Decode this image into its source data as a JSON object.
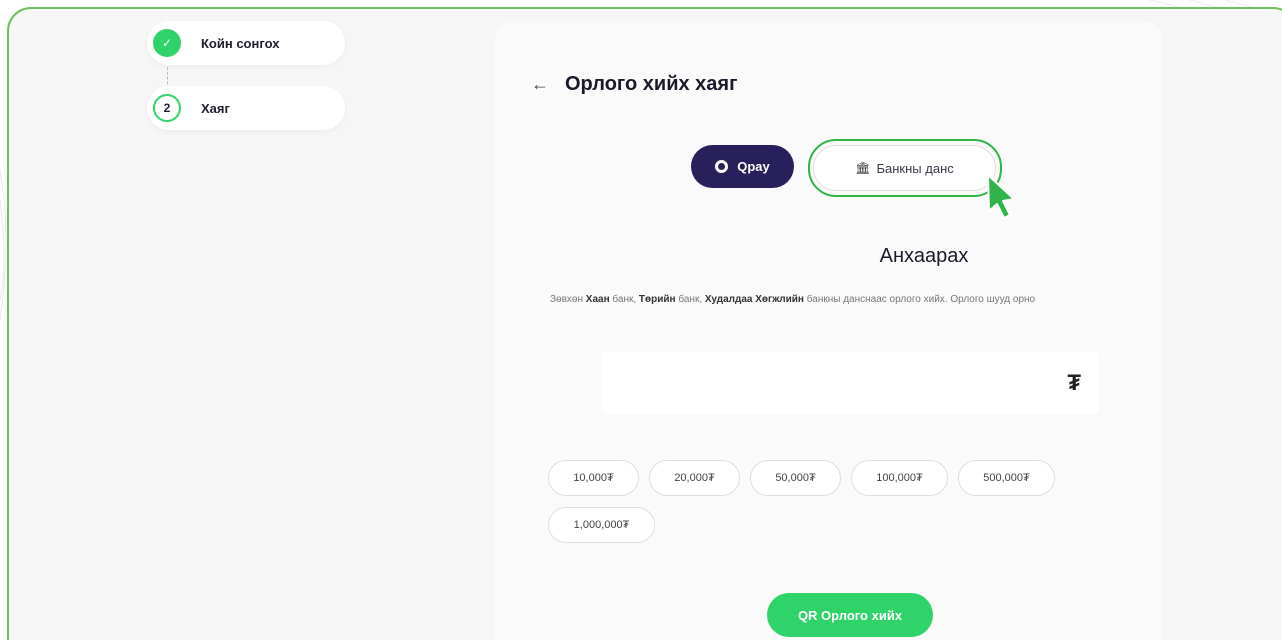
{
  "steps": [
    {
      "label": "Койн сонгох",
      "marker": "✓"
    },
    {
      "label": "Хаяг",
      "marker": "2"
    }
  ],
  "card": {
    "back_icon": "←",
    "title": "Орлого хийх хаяг"
  },
  "methods": {
    "qpay_label": "Qpay",
    "bank_label": "Банкны данс",
    "bank_icon": "🏛"
  },
  "attention": {
    "title": "Анхаарах",
    "prefix": "Зөвхөн ",
    "bank1": "Хаан",
    "mid1": " банк, ",
    "bank2": "Төрийн",
    "mid2": " банк, ",
    "bank3": "Худалдаа Хөгжлийн",
    "suffix": " банкны данснаас орлого хийх. Орлого шууд орно"
  },
  "amount": {
    "currency_symbol": "₮",
    "value": ""
  },
  "presets": [
    "10,000₮",
    "20,000₮",
    "50,000₮",
    "100,000₮",
    "500,000₮",
    "1,000,000₮"
  ],
  "submit_label": "QR Орлого хийх",
  "colors": {
    "accent_green": "#2fd36a",
    "qpay_purple": "#27205a",
    "frame_green": "#6fbf5a"
  }
}
